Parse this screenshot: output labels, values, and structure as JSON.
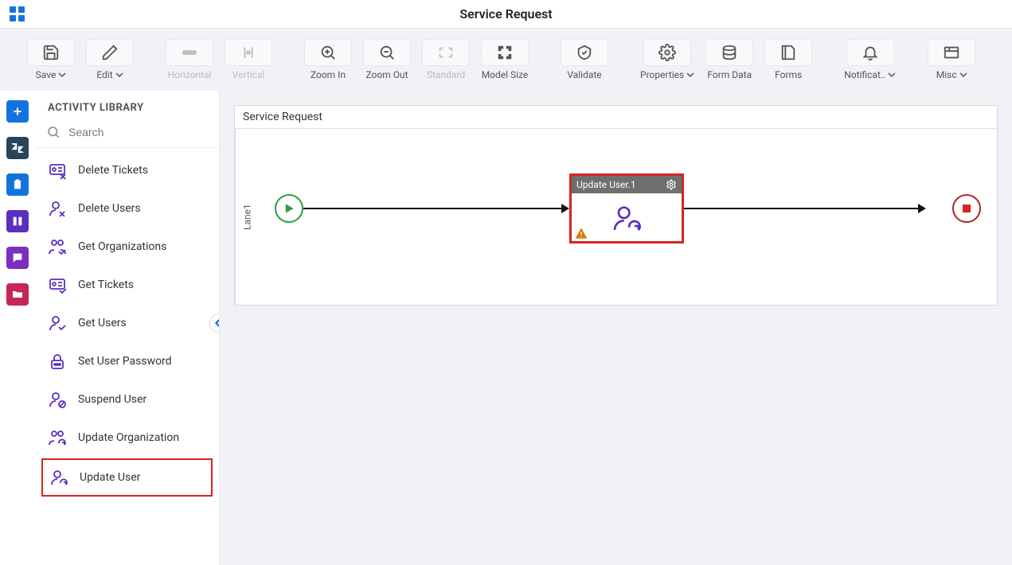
{
  "page_title": "Service Request",
  "toolbar": {
    "save": "Save",
    "edit": "Edit",
    "horizontal": "Horizontal",
    "vertical": "Vertical",
    "zoom_in": "Zoom In",
    "zoom_out": "Zoom Out",
    "standard": "Standard",
    "model_size": "Model Size",
    "validate": "Validate",
    "properties": "Properties",
    "form_data": "Form Data",
    "forms": "Forms",
    "notifications": "Notificat..",
    "misc": "Misc"
  },
  "sidebar": {
    "heading": "ACTIVITY LIBRARY",
    "search_placeholder": "Search",
    "items": [
      {
        "label": "Delete Tickets"
      },
      {
        "label": "Delete Users"
      },
      {
        "label": "Get Organizations"
      },
      {
        "label": "Get Tickets"
      },
      {
        "label": "Get Users"
      },
      {
        "label": "Set User Password"
      },
      {
        "label": "Suspend User"
      },
      {
        "label": "Update Organization"
      },
      {
        "label": "Update User"
      }
    ]
  },
  "canvas": {
    "title": "Service Request",
    "lane_label": "Lane1",
    "activity_label": "Update User.1"
  }
}
